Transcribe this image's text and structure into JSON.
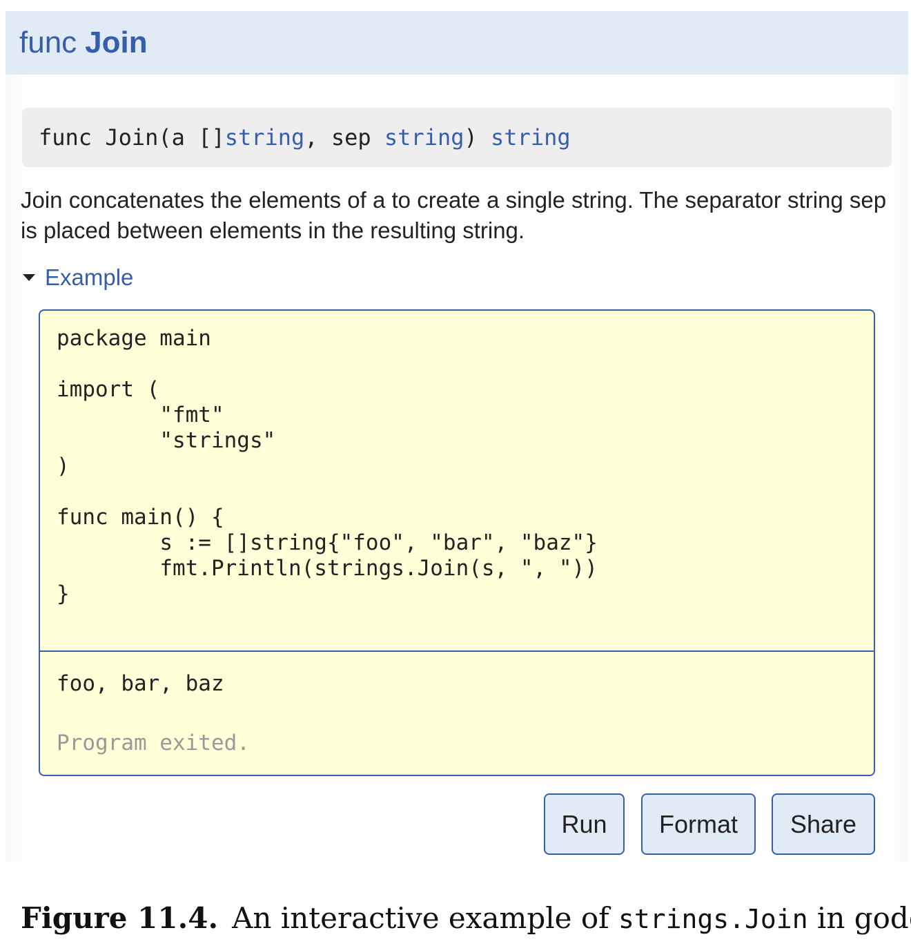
{
  "header": {
    "keyword": "func",
    "name": "Join"
  },
  "signature": {
    "part1": "func Join(a []",
    "type1": "string",
    "part2": ", sep ",
    "type2": "string",
    "part3": ") ",
    "type3": "string"
  },
  "description": "Join concatenates the elements of a to create a single string. The separator string sep is placed between elements in the resulting string.",
  "example": {
    "toggle_label": "Example",
    "code": "package main\n\nimport (\n\t\"fmt\"\n\t\"strings\"\n)\n\nfunc main() {\n\ts := []string{\"foo\", \"bar\", \"baz\"}\n\tfmt.Println(strings.Join(s, \", \"))\n}",
    "output": "foo, bar, baz",
    "status": "Program exited."
  },
  "buttons": {
    "run": "Run",
    "format": "Format",
    "share": "Share"
  },
  "caption": {
    "figure": "Figure 11.4.",
    "text_before": "An interactive example of ",
    "code": "strings.Join",
    "text_after": " in godoc."
  },
  "colors": {
    "link_blue": "#375eab",
    "header_bg": "#e0ebf5",
    "playground_bg": "#ffffd8",
    "signature_bg": "#eeeeee"
  }
}
